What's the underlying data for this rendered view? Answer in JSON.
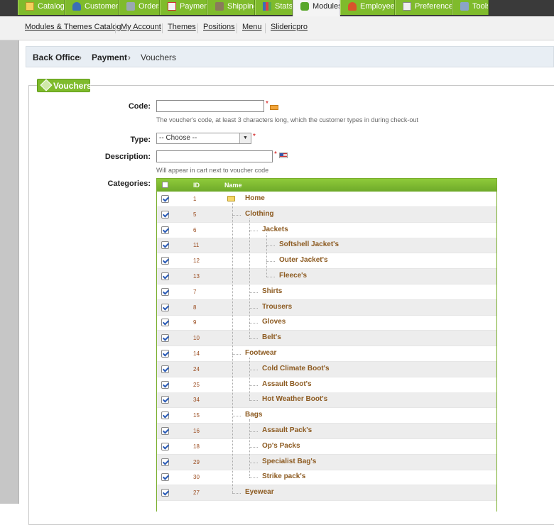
{
  "tabs": [
    {
      "label": "Catalog",
      "icon": "folder-icon"
    },
    {
      "label": "Customers",
      "icon": "customer-icon"
    },
    {
      "label": "Orders",
      "icon": "cart-icon"
    },
    {
      "label": "Payment",
      "icon": "payment-icon"
    },
    {
      "label": "Shipping",
      "icon": "truck-icon"
    },
    {
      "label": "Stats",
      "icon": "chart-icon"
    },
    {
      "label": "Modules",
      "icon": "puzzle-icon",
      "active": true
    },
    {
      "label": "Employees",
      "icon": "employee-icon"
    },
    {
      "label": "Preferences",
      "icon": "preferences-icon"
    },
    {
      "label": "Tools",
      "icon": "wrench-icon"
    }
  ],
  "subtabs": [
    "Modules & Themes Catalog",
    "My Account",
    "Themes",
    "Positions",
    "Menu",
    "Slidericpro"
  ],
  "breadcrumb": [
    "Back Office",
    "Payment",
    "Vouchers"
  ],
  "fieldset": {
    "legend": "Vouchers"
  },
  "form": {
    "code_label": "Code:",
    "code_value": "",
    "code_hint": "The voucher's code, at least 3 characters long, which the customer types in during check-out",
    "type_label": "Type:",
    "type_value": "-- Choose --",
    "description_label": "Description:",
    "description_value": "",
    "description_hint": "Will appear in cart next to voucher code",
    "categories_label": "Categories:",
    "required_mark": "*"
  },
  "table": {
    "col_id": "ID",
    "col_name": "Name",
    "rows": [
      {
        "id": "1",
        "name": "Home",
        "depth": 0,
        "checked": true
      },
      {
        "id": "5",
        "name": "Clothing",
        "depth": 1,
        "checked": true
      },
      {
        "id": "6",
        "name": "Jackets",
        "depth": 2,
        "checked": true
      },
      {
        "id": "11",
        "name": "Softshell Jacket's",
        "depth": 3,
        "checked": true
      },
      {
        "id": "12",
        "name": "Outer Jacket's",
        "depth": 3,
        "checked": true
      },
      {
        "id": "13",
        "name": "Fleece's",
        "depth": 3,
        "checked": true
      },
      {
        "id": "7",
        "name": "Shirts",
        "depth": 2,
        "checked": true
      },
      {
        "id": "8",
        "name": "Trousers",
        "depth": 2,
        "checked": true
      },
      {
        "id": "9",
        "name": "Gloves",
        "depth": 2,
        "checked": true
      },
      {
        "id": "10",
        "name": "Belt's",
        "depth": 2,
        "checked": true
      },
      {
        "id": "14",
        "name": "Footwear",
        "depth": 1,
        "checked": true
      },
      {
        "id": "24",
        "name": "Cold Climate Boot's",
        "depth": 2,
        "checked": true
      },
      {
        "id": "25",
        "name": "Assault Boot's",
        "depth": 2,
        "checked": true
      },
      {
        "id": "34",
        "name": "Hot Weather Boot's",
        "depth": 2,
        "checked": true
      },
      {
        "id": "15",
        "name": "Bags",
        "depth": 1,
        "checked": true
      },
      {
        "id": "16",
        "name": "Assault Pack's",
        "depth": 2,
        "checked": true
      },
      {
        "id": "18",
        "name": "Op's Packs",
        "depth": 2,
        "checked": true
      },
      {
        "id": "29",
        "name": "Specialist Bag's",
        "depth": 2,
        "checked": true
      },
      {
        "id": "30",
        "name": "Strike pack's",
        "depth": 2,
        "checked": true
      },
      {
        "id": "27",
        "name": "Eyewear",
        "depth": 1,
        "checked": true
      }
    ]
  }
}
